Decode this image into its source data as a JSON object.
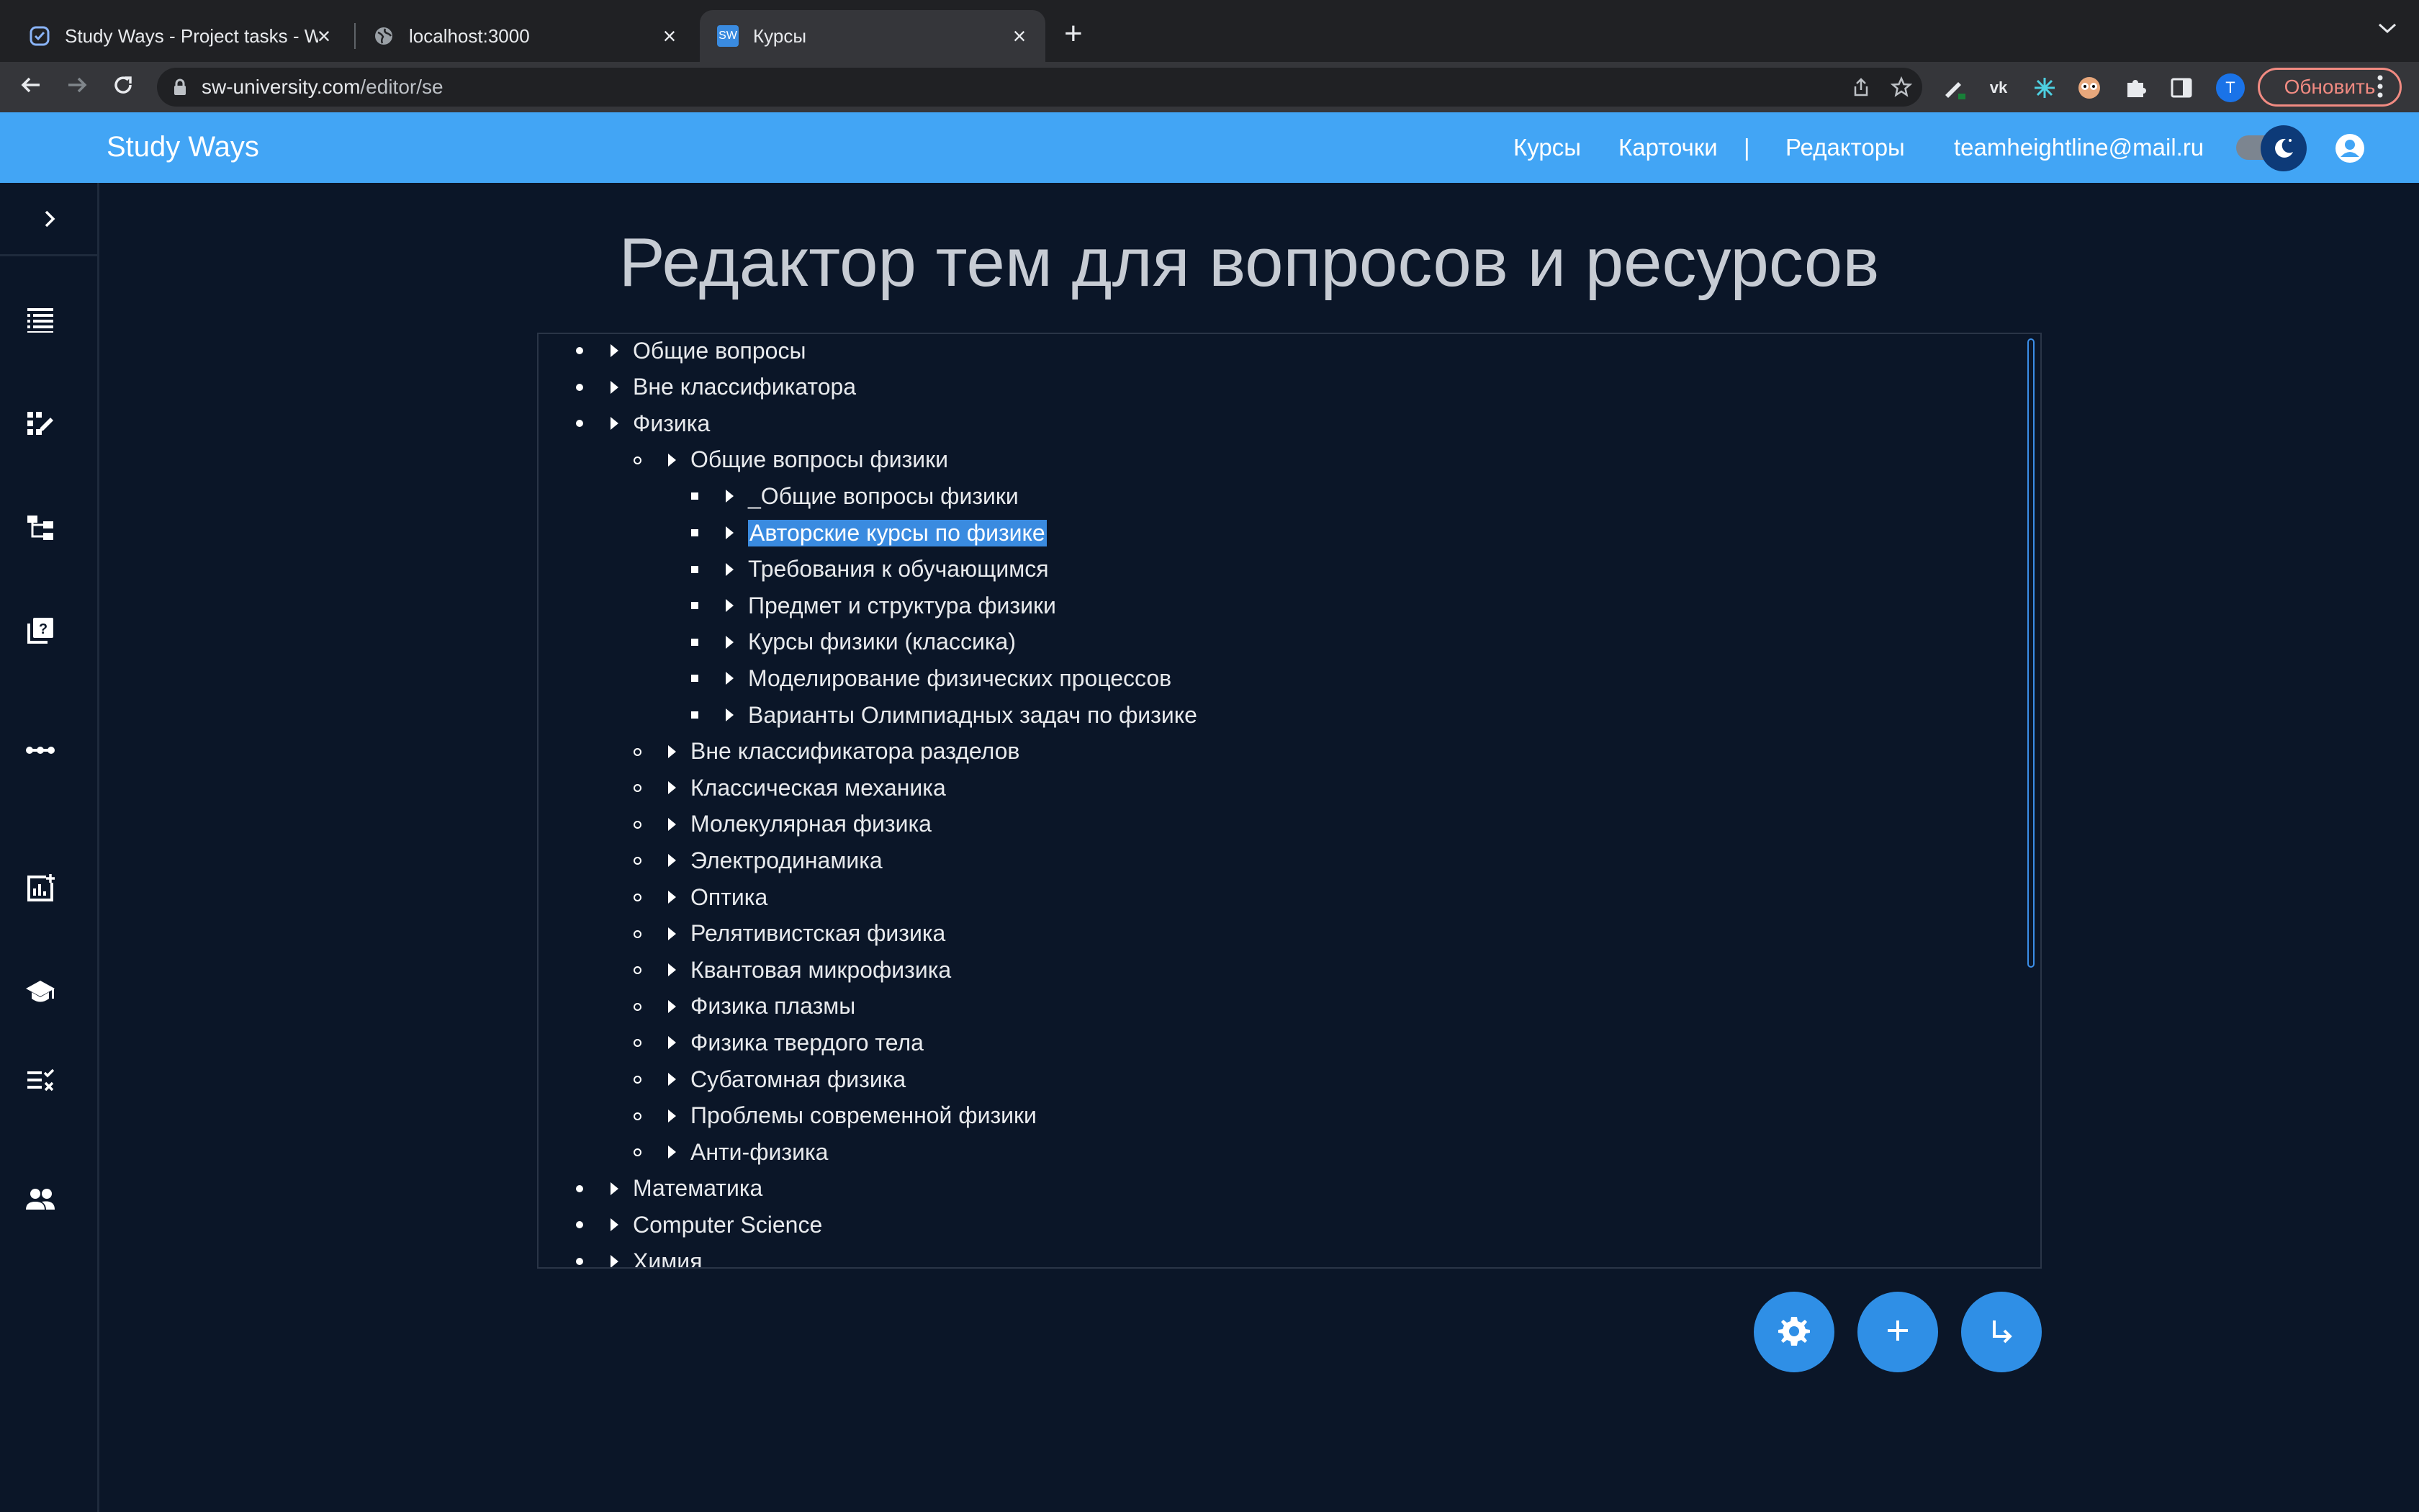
{
  "browser": {
    "tabs": [
      {
        "title": "Study Ways - Project tasks - W",
        "icon": "check-circle-icon",
        "active": false
      },
      {
        "title": "localhost:3000",
        "icon": "globe-icon",
        "active": false
      },
      {
        "title": "Курсы",
        "icon": "sw-logo-icon",
        "favicon_text": "SW",
        "active": true
      }
    ],
    "url_host": "sw-university.com",
    "url_path": "/editor/se",
    "profile_initial": "T",
    "update_label": "Обновить"
  },
  "header": {
    "brand": "Study Ways",
    "nav": [
      "Курсы",
      "Карточки",
      "|",
      "Редакторы"
    ],
    "email": "teamheightline@mail.ru"
  },
  "sidebar": {
    "icons": [
      "chevron-right-icon",
      "list-icon",
      "edit-grid-icon",
      "hierarchy-icon",
      "quiz-icon",
      "more-horiz-icon",
      "add-chart-icon",
      "school-icon",
      "checklist-icon",
      "people-icon"
    ]
  },
  "page": {
    "title": "Редактор тем для вопросов и ресурсов"
  },
  "tree": [
    {
      "label": "Общие вопросы",
      "level": 1
    },
    {
      "label": "Вне классификатора",
      "level": 1
    },
    {
      "label": "Физика",
      "level": 1
    },
    {
      "label": "Общие вопросы физики",
      "level": 2
    },
    {
      "label": "_Общие вопросы физики",
      "level": 3
    },
    {
      "label": "Авторские курсы по физике",
      "level": 3,
      "selected": true
    },
    {
      "label": "Требования к обучающимся",
      "level": 3
    },
    {
      "label": "Предмет и структура физики",
      "level": 3
    },
    {
      "label": "Курсы физики (классика)",
      "level": 3
    },
    {
      "label": "Моделирование физических процессов",
      "level": 3
    },
    {
      "label": "Варианты Олимпиадных задач по физике",
      "level": 3
    },
    {
      "label": "Вне классификатора разделов",
      "level": 2
    },
    {
      "label": "Классическая механика",
      "level": 2
    },
    {
      "label": "Молекулярная физика",
      "level": 2
    },
    {
      "label": "Электродинамика",
      "level": 2
    },
    {
      "label": "Оптика",
      "level": 2
    },
    {
      "label": "Релятивистская физика",
      "level": 2
    },
    {
      "label": "Квантовая микрофизика",
      "level": 2
    },
    {
      "label": "Физика плазмы",
      "level": 2
    },
    {
      "label": "Физика твердого тела",
      "level": 2
    },
    {
      "label": "Субатомная физика",
      "level": 2
    },
    {
      "label": "Проблемы современной физики",
      "level": 2
    },
    {
      "label": "Анти-физика",
      "level": 2
    },
    {
      "label": "Математика",
      "level": 1
    },
    {
      "label": "Computer Science",
      "level": 1
    },
    {
      "label": "Химия",
      "level": 1
    }
  ],
  "fabs": [
    "settings-icon",
    "add-icon",
    "subdirectory-arrow-icon"
  ],
  "colors": {
    "appbar": "#42a5f5",
    "background": "#0b1628",
    "selection": "#3a8be0",
    "fab": "#2f8fe6"
  }
}
